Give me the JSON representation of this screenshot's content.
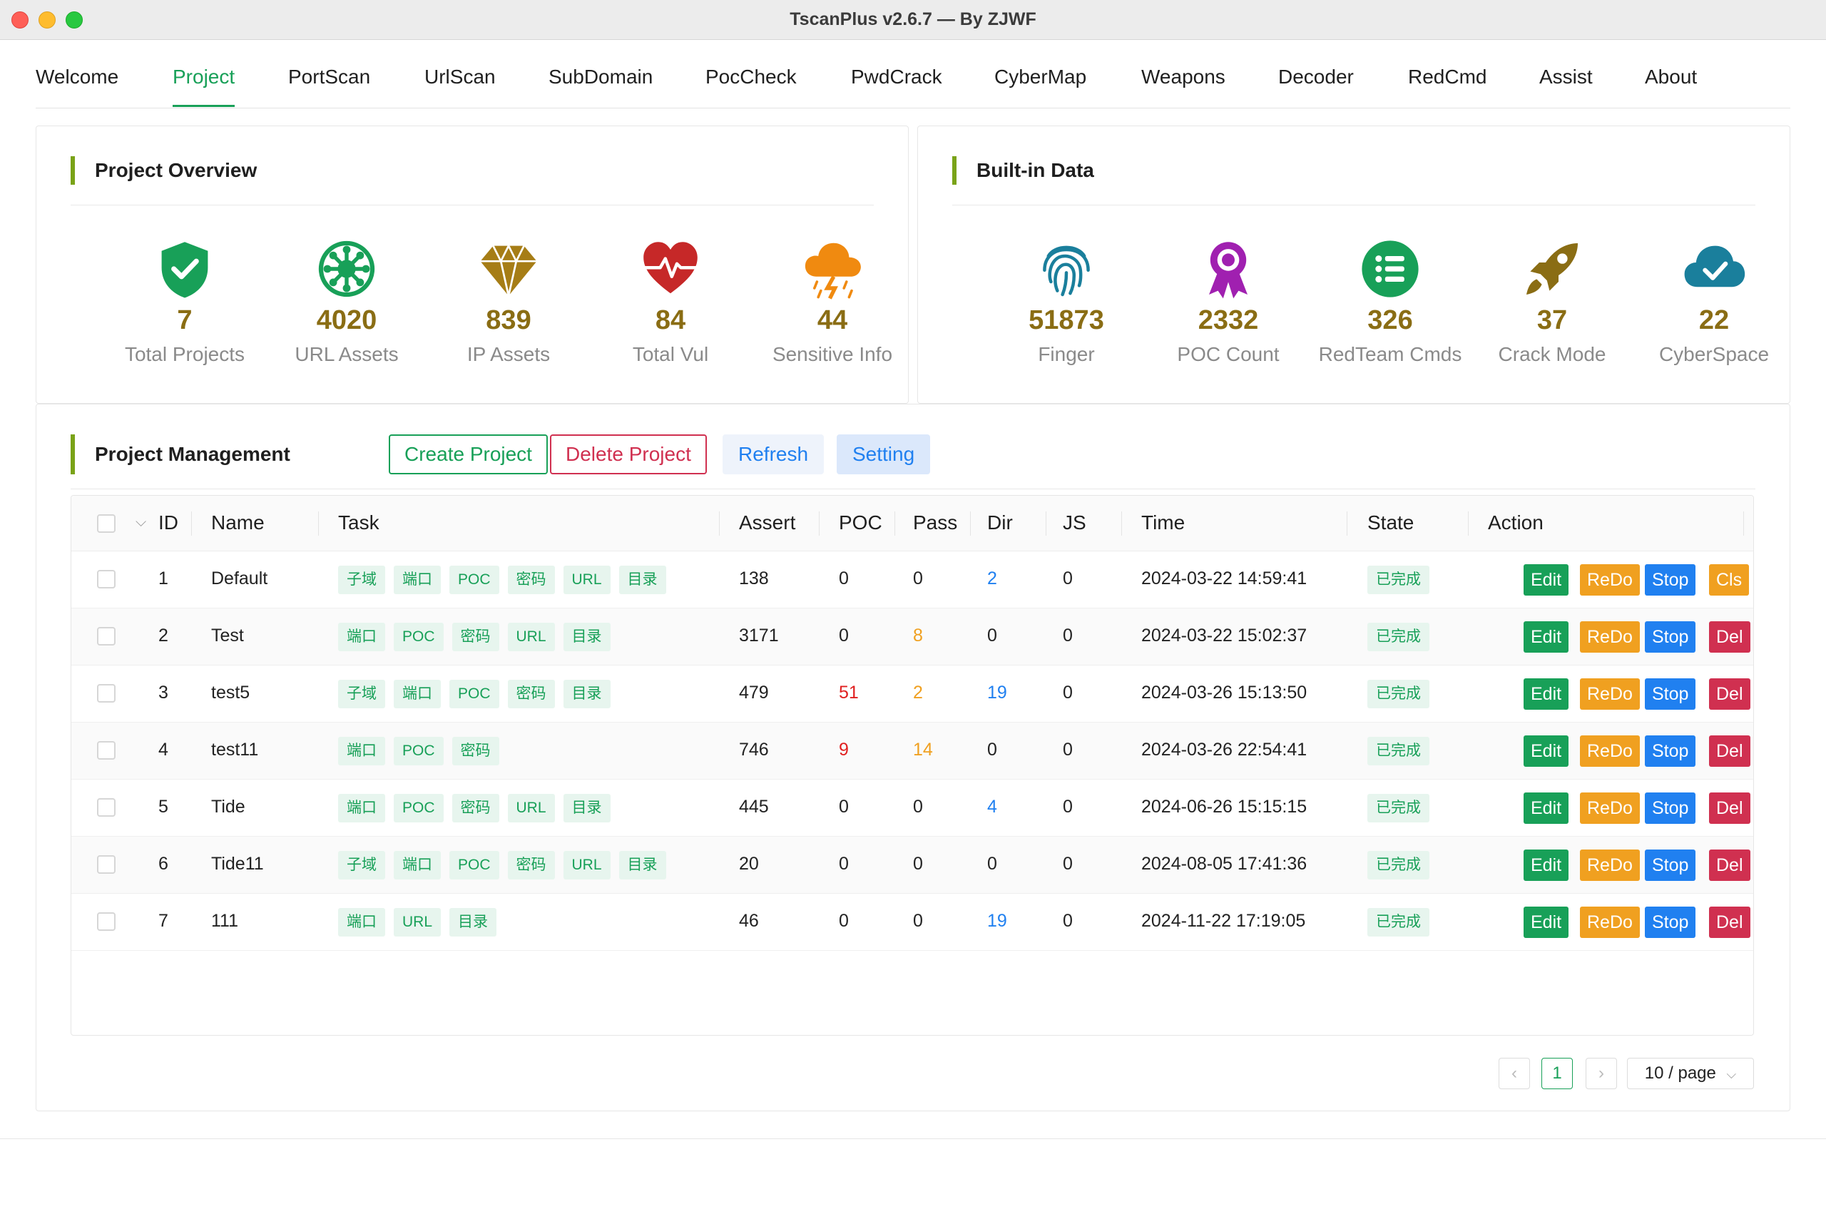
{
  "window": {
    "title": "TscanPlus v2.6.7 — By ZJWF"
  },
  "tabs": [
    {
      "label": "Welcome"
    },
    {
      "label": "Project"
    },
    {
      "label": "PortScan"
    },
    {
      "label": "UrlScan"
    },
    {
      "label": "SubDomain"
    },
    {
      "label": "PocCheck"
    },
    {
      "label": "PwdCrack"
    },
    {
      "label": "CyberMap"
    },
    {
      "label": "Weapons"
    },
    {
      "label": "Decoder"
    },
    {
      "label": "RedCmd"
    },
    {
      "label": "Assist"
    },
    {
      "label": "About"
    }
  ],
  "active_tab": "Project",
  "overview": {
    "title": "Project Overview",
    "stats": [
      {
        "value": "7",
        "label": "Total Projects",
        "icon": "shield-check-icon",
        "color": "#18a058"
      },
      {
        "value": "4020",
        "label": "URL Assets",
        "icon": "virus-icon",
        "color": "#18a058"
      },
      {
        "value": "839",
        "label": "IP Assets",
        "icon": "diamond-icon",
        "color": "#a67d16"
      },
      {
        "value": "84",
        "label": "Total Vul",
        "icon": "heartbeat-icon",
        "color": "#c62828"
      },
      {
        "value": "44",
        "label": "Sensitive Info",
        "icon": "storm-cloud-icon",
        "color": "#f08a10"
      }
    ]
  },
  "builtin": {
    "title": "Built-in Data",
    "stats": [
      {
        "value": "51873",
        "label": "Finger",
        "icon": "fingerprint-icon",
        "color": "#1a7f9c"
      },
      {
        "value": "2332",
        "label": "POC Count",
        "icon": "award-ribbon-icon",
        "color": "#a020b0"
      },
      {
        "value": "326",
        "label": "RedTeam Cmds",
        "icon": "list-circle-icon",
        "color": "#18a058"
      },
      {
        "value": "37",
        "label": "Crack Mode",
        "icon": "rocket-icon",
        "color": "#8a6d14"
      },
      {
        "value": "22",
        "label": "CyberSpace",
        "icon": "cloud-check-icon",
        "color": "#1a7f9c"
      }
    ]
  },
  "management": {
    "title": "Project Management",
    "buttons": {
      "create": "Create Project",
      "delete": "Delete Project",
      "refresh": "Refresh",
      "setting": "Setting"
    },
    "columns": [
      "ID",
      "Name",
      "Task",
      "Assert",
      "POC",
      "Pass",
      "Dir",
      "JS",
      "Time",
      "State",
      "Action"
    ],
    "actions": {
      "edit": "Edit",
      "redo": "ReDo",
      "stop": "Stop",
      "del": "Del",
      "cls": "Cls"
    },
    "rows": [
      {
        "id": "1",
        "name": "Default",
        "tasks": [
          "子域",
          "端口",
          "POC",
          "密码",
          "URL",
          "目录"
        ],
        "assert": "138",
        "poc": "0",
        "pass": "0",
        "dir": "2",
        "js": "0",
        "time": "2024-03-22 14:59:41",
        "state": "已完成",
        "last_action": "Cls"
      },
      {
        "id": "2",
        "name": "Test",
        "tasks": [
          "端口",
          "POC",
          "密码",
          "URL",
          "目录"
        ],
        "assert": "3171",
        "poc": "0",
        "pass": "8",
        "dir": "0",
        "js": "0",
        "time": "2024-03-22 15:02:37",
        "state": "已完成",
        "last_action": "Del"
      },
      {
        "id": "3",
        "name": "test5",
        "tasks": [
          "子域",
          "端口",
          "POC",
          "密码",
          "目录"
        ],
        "assert": "479",
        "poc": "51",
        "pass": "2",
        "dir": "19",
        "js": "0",
        "time": "2024-03-26 15:13:50",
        "state": "已完成",
        "last_action": "Del"
      },
      {
        "id": "4",
        "name": "test11",
        "tasks": [
          "端口",
          "POC",
          "密码"
        ],
        "assert": "746",
        "poc": "9",
        "pass": "14",
        "dir": "0",
        "js": "0",
        "time": "2024-03-26 22:54:41",
        "state": "已完成",
        "last_action": "Del"
      },
      {
        "id": "5",
        "name": "Tide",
        "tasks": [
          "端口",
          "POC",
          "密码",
          "URL",
          "目录"
        ],
        "assert": "445",
        "poc": "0",
        "pass": "0",
        "dir": "4",
        "js": "0",
        "time": "2024-06-26 15:15:15",
        "state": "已完成",
        "last_action": "Del"
      },
      {
        "id": "6",
        "name": "Tide11",
        "tasks": [
          "子域",
          "端口",
          "POC",
          "密码",
          "URL",
          "目录"
        ],
        "assert": "20",
        "poc": "0",
        "pass": "0",
        "dir": "0",
        "js": "0",
        "time": "2024-08-05 17:41:36",
        "state": "已完成",
        "last_action": "Del"
      },
      {
        "id": "7",
        "name": "111",
        "tasks": [
          "端口",
          "URL",
          "目录"
        ],
        "assert": "46",
        "poc": "0",
        "pass": "0",
        "dir": "19",
        "js": "0",
        "time": "2024-11-22 17:19:05",
        "state": "已完成",
        "last_action": "Del"
      }
    ],
    "pagination": {
      "current": "1",
      "page_size": "10 / page"
    }
  },
  "colors": {
    "accent": "#18a058",
    "warning": "#f0a020",
    "info": "#2080f0",
    "error": "#d03050"
  }
}
